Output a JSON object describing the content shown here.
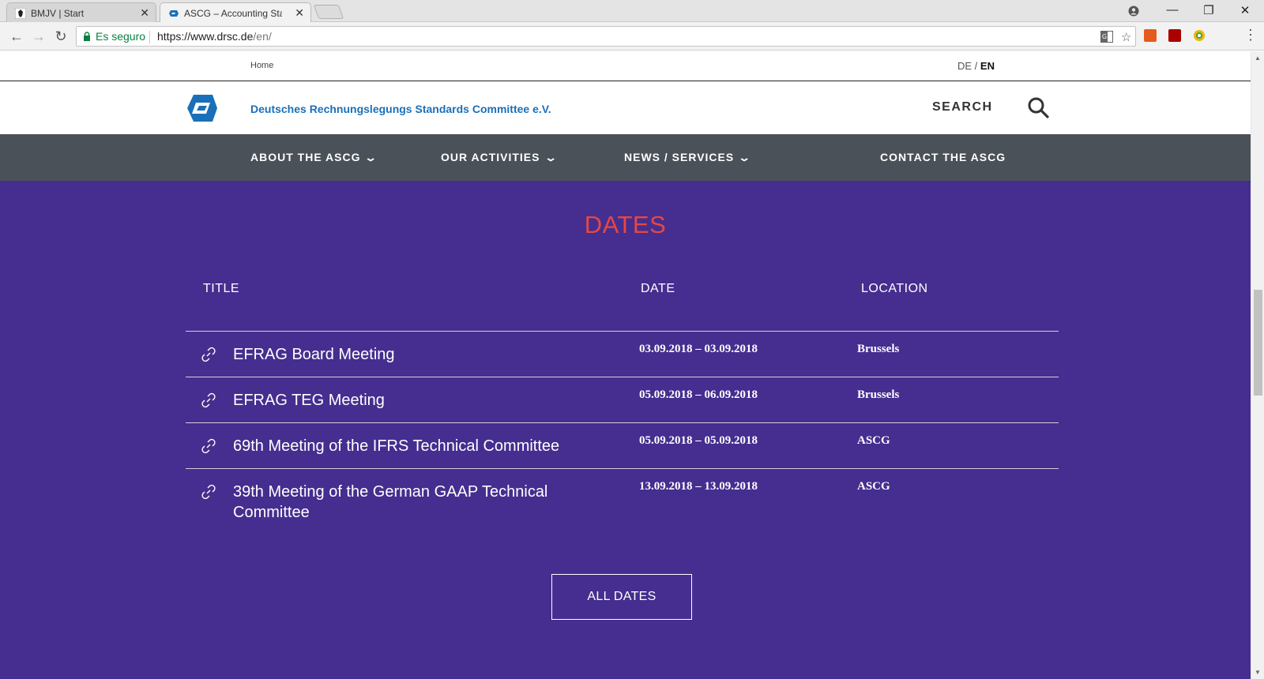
{
  "browser": {
    "tabs": [
      {
        "title": "BMJV | Start",
        "close": "✕"
      },
      {
        "title": "ASCG – Accounting Stanc",
        "close": "✕"
      }
    ],
    "window_controls": {
      "minimize": "—",
      "restore": "❐",
      "close": "✕"
    },
    "secure_label": "Es seguro",
    "url_host": "https://www.drsc.de",
    "url_path": "/en/"
  },
  "page": {
    "breadcrumb": "Home",
    "lang_de": "DE",
    "lang_sep": " / ",
    "lang_en": "EN",
    "org_name": "Deutsches Rechnungslegungs Standards Committee e.V.",
    "search_label": "SEARCH",
    "nav": [
      {
        "label": "ABOUT THE ASCG"
      },
      {
        "label": "OUR ACTIVITIES"
      },
      {
        "label": "NEWS / SERVICES"
      },
      {
        "label": "CONTACT THE ASCG"
      }
    ],
    "nav_chevron": "❯",
    "dates": {
      "title": "DATES",
      "headers": {
        "title": "TITLE",
        "date": "DATE",
        "location": "LOCATION"
      },
      "rows": [
        {
          "title": "EFRAG Board Meeting",
          "date": "03.09.2018 – 03.09.2018",
          "location": "Brussels"
        },
        {
          "title": "EFRAG TEG Meeting",
          "date": "05.09.2018 – 06.09.2018",
          "location": "Brussels"
        },
        {
          "title": "69th Meeting of the IFRS Technical Committee",
          "date": "05.09.2018 – 05.09.2018",
          "location": "ASCG"
        },
        {
          "title": "39th Meeting of the German GAAP Technical Committee",
          "date": "13.09.2018 – 13.09.2018",
          "location": "ASCG"
        }
      ],
      "all_dates_label": "ALL DATES"
    }
  },
  "colors": {
    "section_bg": "#452e8f",
    "title_red": "#e54745",
    "nav_bg": "#4b5158",
    "brand_blue": "#1a70b8"
  }
}
